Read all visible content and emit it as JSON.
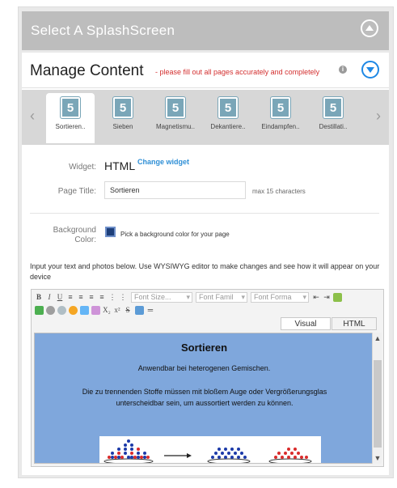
{
  "header": {
    "title": "Select A SplashScreen"
  },
  "manage": {
    "title": "Manage Content",
    "note": "- please fill out all pages accurately and completely",
    "info_icon": "i"
  },
  "pages": [
    {
      "label": "Sortieren..",
      "icon": "html5-icon",
      "active": true
    },
    {
      "label": "Sieben",
      "icon": "html5-icon"
    },
    {
      "label": "Magnetismu..",
      "icon": "html5-icon"
    },
    {
      "label": "Dekantiere..",
      "icon": "html5-icon"
    },
    {
      "label": "Eindampfen..",
      "icon": "html5-icon"
    },
    {
      "label": "Destillati..",
      "icon": "html5-icon"
    }
  ],
  "carousel": {
    "left_arrow": "‹",
    "right_arrow": "›"
  },
  "form": {
    "widget_label": "Widget:",
    "widget_value": "HTML",
    "change_widget": "Change widget",
    "page_title_label": "Page Title:",
    "page_title_value": "Sortieren",
    "max_chars": "max 15 characters",
    "bg_label": "Background Color:",
    "bg_color": "#1d3f7a",
    "pick_text": "Pick a background color for your page"
  },
  "instructions": "Input your text and photos below. Use WYSIWYG editor to make changes and see how it will appear on your device",
  "editor": {
    "toolbar": {
      "bold": "B",
      "italic": "I",
      "underline": "U",
      "font_size": "Font Size...",
      "font_family": "Font Famil",
      "font_format": "Font Forma",
      "subscript": "X₂",
      "superscript": "x²",
      "strike": "S"
    },
    "tabs": {
      "visual": "Visual",
      "html": "HTML"
    },
    "content": {
      "heading": "Sortieren",
      "p1": "Anwendbar bei heterogenen Gemischen.",
      "p2": "Die zu trennenden Stoffe müssen mit bloßem Auge oder Vergrößerungsglas unterscheidbar sein, um aussortiert werden zu können.",
      "background": "#7fa7dc"
    },
    "scroll": {
      "up": "▲",
      "down": "▼"
    }
  }
}
